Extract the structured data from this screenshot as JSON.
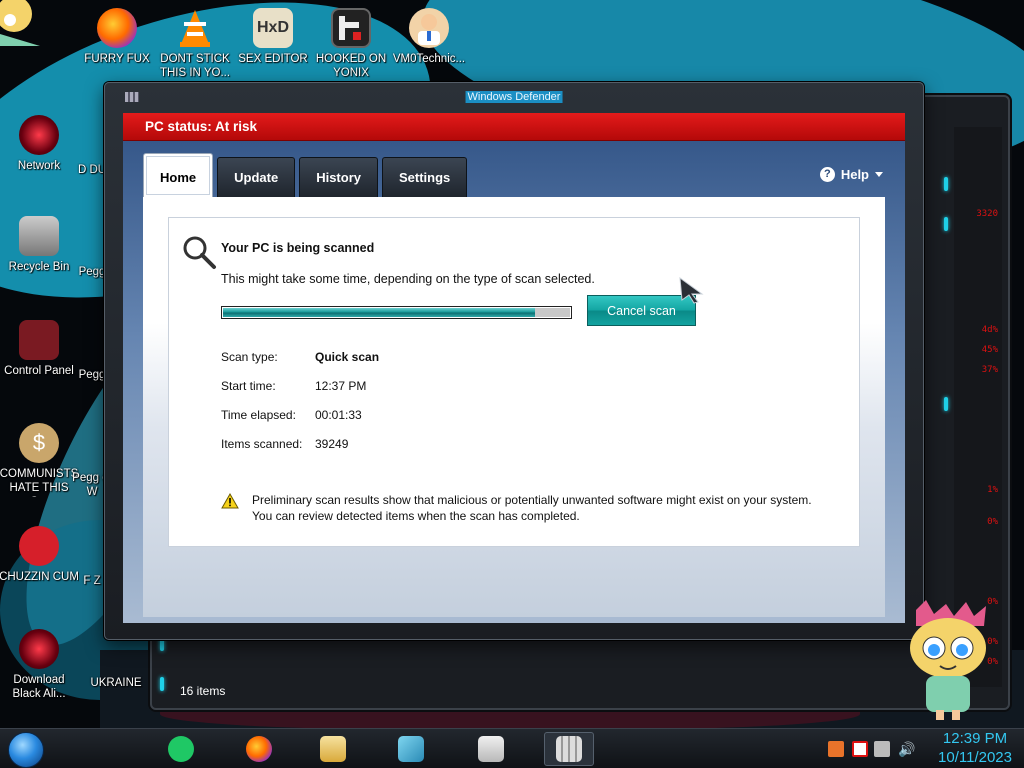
{
  "desktop": {
    "top_icons": [
      {
        "label": "FURRY FUX",
        "icon": "firefox-icon"
      },
      {
        "label": "DONT STICK THIS IN YO...",
        "icon": "vlc-icon"
      },
      {
        "label": "SEX EDITOR",
        "icon": "hxd-icon"
      },
      {
        "label": "HOOKED ON YONIX",
        "icon": "game-icon"
      },
      {
        "label": "VM0Technic...",
        "icon": "doctor-icon"
      }
    ],
    "left_icons": [
      {
        "label": "Network",
        "icon": "network-icon"
      },
      {
        "label": "Recycle Bin",
        "icon": "recycle-bin-icon"
      },
      {
        "label": "Control Panel",
        "icon": "control-panel-icon"
      },
      {
        "label": "COMMUNISTS HATE THIS G...",
        "icon": "money-bag-icon"
      },
      {
        "label": "CHUZZIN CUM",
        "icon": "chuzzle-icon"
      },
      {
        "label": "Download Black Ali...",
        "icon": "network-icon"
      }
    ],
    "second_column": [
      {
        "label": "D DU"
      },
      {
        "label": "Pegg"
      },
      {
        "label": "Pegg"
      },
      {
        "label": "Pegg of W"
      },
      {
        "label": "F Z"
      },
      {
        "label": "UKRAINE"
      }
    ]
  },
  "explorer": {
    "status_text": "16 items",
    "red_values": [
      "3320",
      "4d%",
      "45%",
      "37%",
      "1%",
      "0%",
      "0%",
      "0%",
      "0%"
    ]
  },
  "defender": {
    "window_title": "Windows Defender",
    "pc_status": "PC status: At risk",
    "tabs": [
      {
        "label": "Home",
        "active": true
      },
      {
        "label": "Update",
        "active": false
      },
      {
        "label": "History",
        "active": false
      },
      {
        "label": "Settings",
        "active": false
      }
    ],
    "help_label": "Help",
    "scan": {
      "heading": "Your PC is being scanned",
      "subtext": "This might take some time, depending on the type of scan selected.",
      "progress": 0.9,
      "cancel_label": "Cancel scan",
      "rows": [
        {
          "label": "Scan type:",
          "value": "Quick scan",
          "bold": true
        },
        {
          "label": "Start time:",
          "value": "12:37 PM",
          "bold": false
        },
        {
          "label": "Time elapsed:",
          "value": "00:01:33",
          "bold": false
        },
        {
          "label": "Items scanned:",
          "value": "39249",
          "bold": false
        }
      ],
      "warning_line1": "Preliminary scan results show that malicious or potentially unwanted software might exist on your system.",
      "warning_line2": "You can review detected items when the scan has completed."
    }
  },
  "taskbar": {
    "time": "12:39 PM",
    "date": "10/11/2023",
    "buttons": [
      "notes-icon",
      "firefox-icon",
      "explorer-icon",
      "pencil-app-icon",
      "printer-icon",
      "defender-icon"
    ]
  },
  "colors": {
    "status_red": "#d10f0f",
    "accent_teal": "#14a6a3",
    "clock_blue": "#33c7f0"
  }
}
